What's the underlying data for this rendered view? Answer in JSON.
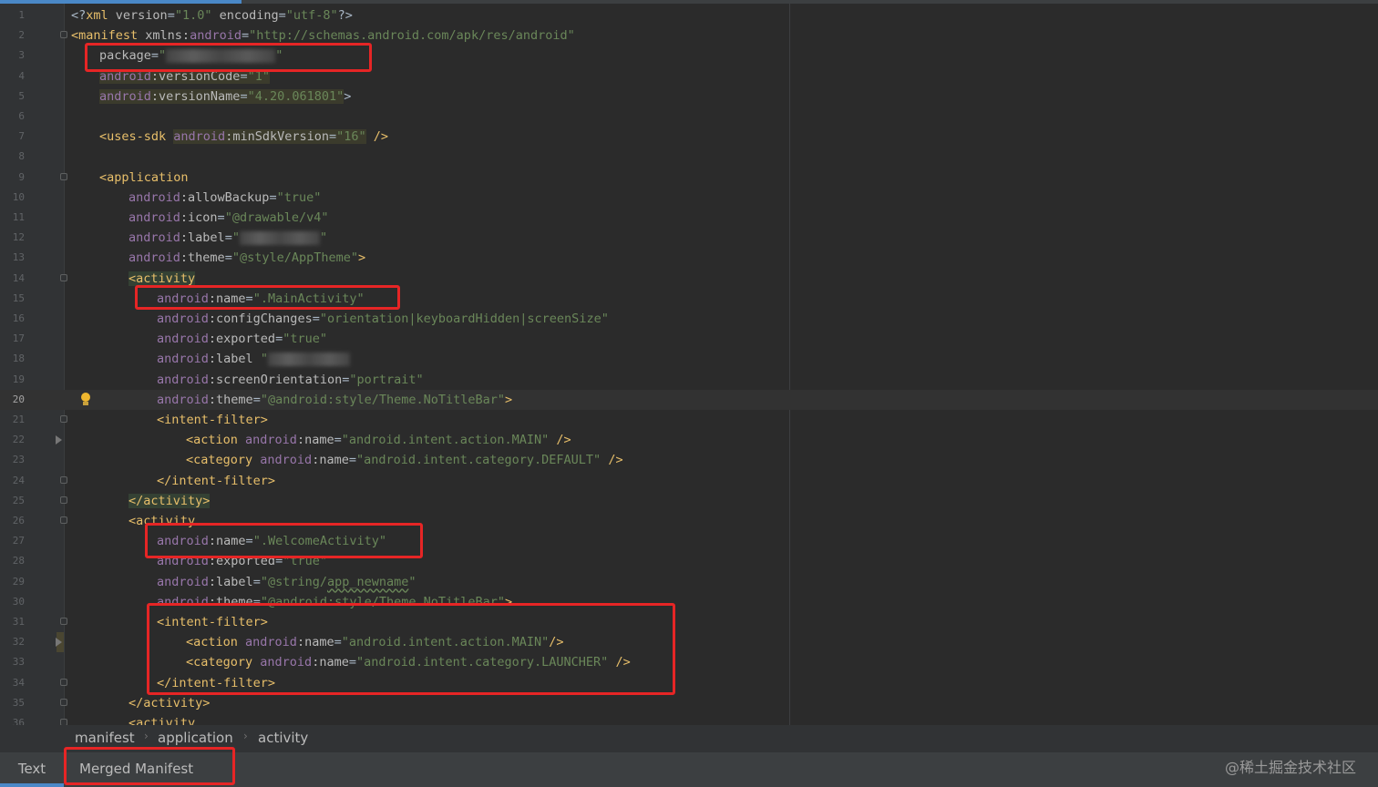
{
  "editor": {
    "current_line": 20,
    "lines": [
      {
        "n": "1",
        "tokens": [
          [
            "p",
            "<?"
          ],
          [
            "t",
            "xml "
          ],
          [
            "at",
            "version"
          ],
          [
            "p",
            "="
          ],
          [
            "s",
            "\"1.0\""
          ],
          [
            "at",
            " encoding"
          ],
          [
            "p",
            "="
          ],
          [
            "s",
            "\"utf-8\""
          ],
          [
            "p",
            "?>"
          ]
        ]
      },
      {
        "n": "2",
        "tokens": [
          [
            "t",
            "<manifest "
          ],
          [
            "at",
            "xmlns:"
          ],
          [
            "ns",
            "android"
          ],
          [
            "p",
            "="
          ],
          [
            "s",
            "\"http://schemas.android.com/apk/res/android\""
          ]
        ]
      },
      {
        "n": "3",
        "tokens": [
          [
            "at",
            "package"
          ],
          [
            "p",
            "="
          ],
          [
            "s",
            "\""
          ],
          [
            "blur",
            ""
          ],
          [
            "s",
            "\""
          ]
        ]
      },
      {
        "n": "4",
        "tokens": [
          [
            "ns hl",
            "android"
          ],
          [
            "at hl",
            ":versionCode"
          ],
          [
            "p hl",
            "="
          ],
          [
            "s hl",
            "\"1\""
          ]
        ]
      },
      {
        "n": "5",
        "tokens": [
          [
            "ns hl",
            "android"
          ],
          [
            "at hl",
            ":versionName"
          ],
          [
            "p hl",
            "="
          ],
          [
            "s hl",
            "\"4.20.061801\""
          ],
          [
            "p",
            ">"
          ]
        ]
      },
      {
        "n": "6",
        "tokens": []
      },
      {
        "n": "7",
        "tokens": [
          [
            "t",
            "<uses-sdk "
          ],
          [
            "ns hl",
            "android"
          ],
          [
            "at hl",
            ":minSdkVersion"
          ],
          [
            "p hl",
            "="
          ],
          [
            "s hl",
            "\"16\""
          ],
          [
            "t",
            " />"
          ]
        ]
      },
      {
        "n": "8",
        "tokens": []
      },
      {
        "n": "9",
        "tokens": [
          [
            "t",
            "<application"
          ]
        ]
      },
      {
        "n": "10",
        "tokens": [
          [
            "ns",
            "android"
          ],
          [
            "at",
            ":allowBackup"
          ],
          [
            "p",
            "="
          ],
          [
            "s",
            "\"true\""
          ]
        ]
      },
      {
        "n": "11",
        "tokens": [
          [
            "ns",
            "android"
          ],
          [
            "at",
            ":icon"
          ],
          [
            "p",
            "="
          ],
          [
            "s",
            "\"@drawable/v4\""
          ]
        ]
      },
      {
        "n": "12",
        "tokens": [
          [
            "ns",
            "android"
          ],
          [
            "at",
            ":label"
          ],
          [
            "p",
            "="
          ],
          [
            "s",
            "\""
          ],
          [
            "blur short",
            ""
          ],
          [
            "s",
            "\""
          ]
        ]
      },
      {
        "n": "13",
        "tokens": [
          [
            "ns",
            "android"
          ],
          [
            "at",
            ":theme"
          ],
          [
            "p",
            "="
          ],
          [
            "s",
            "\"@style/AppTheme\""
          ],
          [
            "t",
            ">"
          ]
        ]
      },
      {
        "n": "14",
        "tokens": [
          [
            "t match",
            "<activity"
          ]
        ]
      },
      {
        "n": "15",
        "tokens": [
          [
            "ns",
            "android"
          ],
          [
            "at",
            ":name"
          ],
          [
            "p",
            "="
          ],
          [
            "s",
            "\".MainActivity\""
          ]
        ]
      },
      {
        "n": "16",
        "tokens": [
          [
            "ns",
            "android"
          ],
          [
            "at",
            ":configChanges"
          ],
          [
            "p",
            "="
          ],
          [
            "s",
            "\"orientation|keyboardHidden|screenSize\""
          ]
        ]
      },
      {
        "n": "17",
        "tokens": [
          [
            "ns",
            "android"
          ],
          [
            "at",
            ":exported"
          ],
          [
            "p",
            "="
          ],
          [
            "s",
            "\"true\""
          ]
        ]
      },
      {
        "n": "18",
        "tokens": [
          [
            "ns",
            "android"
          ],
          [
            "at",
            ":label"
          ],
          [
            "p",
            " "
          ],
          [
            "s",
            "\""
          ],
          [
            "blur mid",
            ""
          ]
        ]
      },
      {
        "n": "19",
        "tokens": [
          [
            "ns",
            "android"
          ],
          [
            "at",
            ":screenOrientation"
          ],
          [
            "p",
            "="
          ],
          [
            "s",
            "\"portrait\""
          ]
        ]
      },
      {
        "n": "20",
        "tokens": [
          [
            "ns",
            "android"
          ],
          [
            "at",
            ":theme"
          ],
          [
            "p",
            "="
          ],
          [
            "s",
            "\"@android:style/Theme.NoTitleBar\""
          ],
          [
            "t",
            ">"
          ]
        ]
      },
      {
        "n": "21",
        "tokens": [
          [
            "t",
            "<intent-filter>"
          ]
        ]
      },
      {
        "n": "22",
        "tokens": [
          [
            "t",
            "<action "
          ],
          [
            "ns",
            "android"
          ],
          [
            "at",
            ":name"
          ],
          [
            "p",
            "="
          ],
          [
            "s",
            "\"android.intent.action.MAIN\""
          ],
          [
            "t",
            " />"
          ]
        ]
      },
      {
        "n": "23",
        "tokens": [
          [
            "t",
            "<category "
          ],
          [
            "ns",
            "android"
          ],
          [
            "at",
            ":name"
          ],
          [
            "p",
            "="
          ],
          [
            "s",
            "\"android.intent.category.DEFAULT\""
          ],
          [
            "t",
            " />"
          ]
        ]
      },
      {
        "n": "24",
        "tokens": [
          [
            "t",
            "</intent-filter>"
          ]
        ]
      },
      {
        "n": "25",
        "tokens": [
          [
            "t match",
            "</activity>"
          ]
        ]
      },
      {
        "n": "26",
        "tokens": [
          [
            "t",
            "<activity"
          ]
        ]
      },
      {
        "n": "27",
        "tokens": [
          [
            "ns",
            "android"
          ],
          [
            "at",
            ":name"
          ],
          [
            "p",
            "="
          ],
          [
            "s",
            "\".WelcomeActivity\""
          ]
        ]
      },
      {
        "n": "28",
        "tokens": [
          [
            "ns",
            "android"
          ],
          [
            "at",
            ":exported"
          ],
          [
            "p",
            "="
          ],
          [
            "s",
            "\"true\""
          ]
        ]
      },
      {
        "n": "29",
        "tokens": [
          [
            "ns",
            "android"
          ],
          [
            "at",
            ":label"
          ],
          [
            "p",
            "="
          ],
          [
            "s",
            "\"@string/"
          ],
          [
            "s squig",
            "app_newname"
          ],
          [
            "s",
            "\""
          ]
        ]
      },
      {
        "n": "30",
        "tokens": [
          [
            "ns",
            "android"
          ],
          [
            "at",
            ":theme"
          ],
          [
            "p",
            "="
          ],
          [
            "s",
            "\"@android:style/Theme.NoTitleBar\""
          ],
          [
            "t",
            ">"
          ]
        ]
      },
      {
        "n": "31",
        "tokens": [
          [
            "t",
            "<intent-filter>"
          ]
        ]
      },
      {
        "n": "32",
        "tokens": [
          [
            "t",
            "<action "
          ],
          [
            "ns",
            "android"
          ],
          [
            "at",
            ":name"
          ],
          [
            "p",
            "="
          ],
          [
            "s",
            "\"android.intent.action.MAIN\""
          ],
          [
            "t",
            "/>"
          ]
        ]
      },
      {
        "n": "33",
        "tokens": [
          [
            "t",
            "<category "
          ],
          [
            "ns",
            "android"
          ],
          [
            "at",
            ":name"
          ],
          [
            "p",
            "="
          ],
          [
            "s",
            "\"android.intent.category.LAUNCHER\""
          ],
          [
            "t",
            " />"
          ]
        ]
      },
      {
        "n": "34",
        "tokens": [
          [
            "t",
            "</intent-filter>"
          ]
        ]
      },
      {
        "n": "35",
        "tokens": [
          [
            "t",
            "</activity>"
          ]
        ]
      },
      {
        "n": "36",
        "tokens": [
          [
            "t",
            "<activity"
          ]
        ]
      }
    ]
  },
  "breadcrumb": {
    "items": [
      "manifest",
      "application",
      "activity"
    ]
  },
  "tabs": {
    "text": "Text",
    "merged": "Merged Manifest"
  },
  "watermark": "@稀土掘金技术社区",
  "colors": {
    "highlight_box": "#e62525",
    "active_tab": "#4a88c7",
    "background": "#2b2b2b"
  }
}
